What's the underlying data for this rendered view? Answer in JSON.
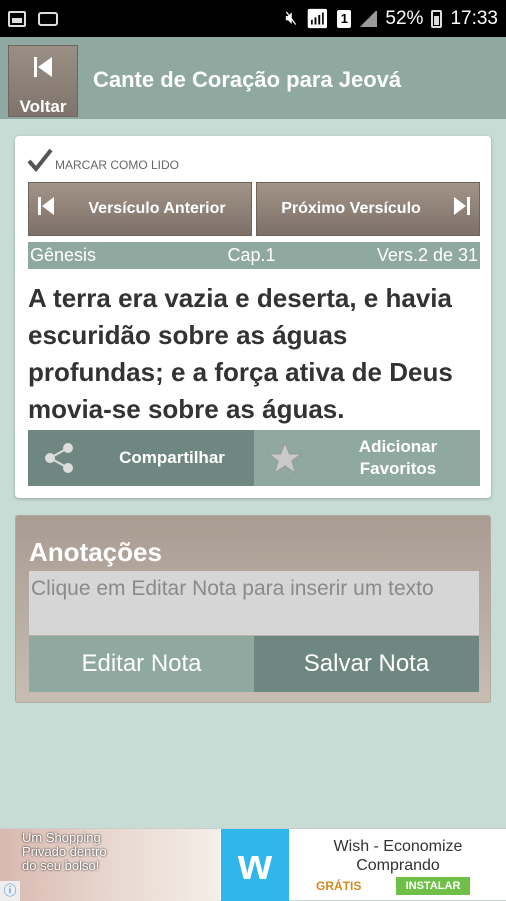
{
  "status_bar": {
    "battery": "52%",
    "time": "17:33",
    "sim": "1"
  },
  "app_bar": {
    "back_label": "Voltar",
    "title": "Cante de Coração para Jeová"
  },
  "card": {
    "mark_read_label": "MARCAR COMO LIDO",
    "prev_label": "Versículo Anterior",
    "next_label": "Próximo Versículo",
    "book": "Gênesis",
    "chapter": "Cap.1",
    "verse_ref": "Vers.2 de 31",
    "verse_text": "A terra era vazia e deserta, e havia escuridão sobre as águas profundas; e a força ativa de Deus movia-se sobre as águas.",
    "share_label": "Compartilhar",
    "fav_label_1": "Adicionar",
    "fav_label_2": "Favoritos"
  },
  "notes": {
    "title": "Anotações",
    "placeholder": "Clique em Editar Nota para inserir um texto",
    "edit_label": "Editar Nota",
    "save_label": "Salvar Nota"
  },
  "ad": {
    "promo_text_1": "Um Shopping",
    "promo_text_2": "Privado dentro",
    "promo_text_3": "do seu bolso!",
    "logo_letter": "w",
    "title_1": "Wish - Economize",
    "title_2": "Comprando",
    "free_label": "GRÁTIS",
    "install_label": "INSTALAR"
  },
  "colors": {
    "teal": "#8fa8a0",
    "dark_teal": "#6e8780",
    "background": "#c7dcd5",
    "brown": "#8f8379"
  }
}
